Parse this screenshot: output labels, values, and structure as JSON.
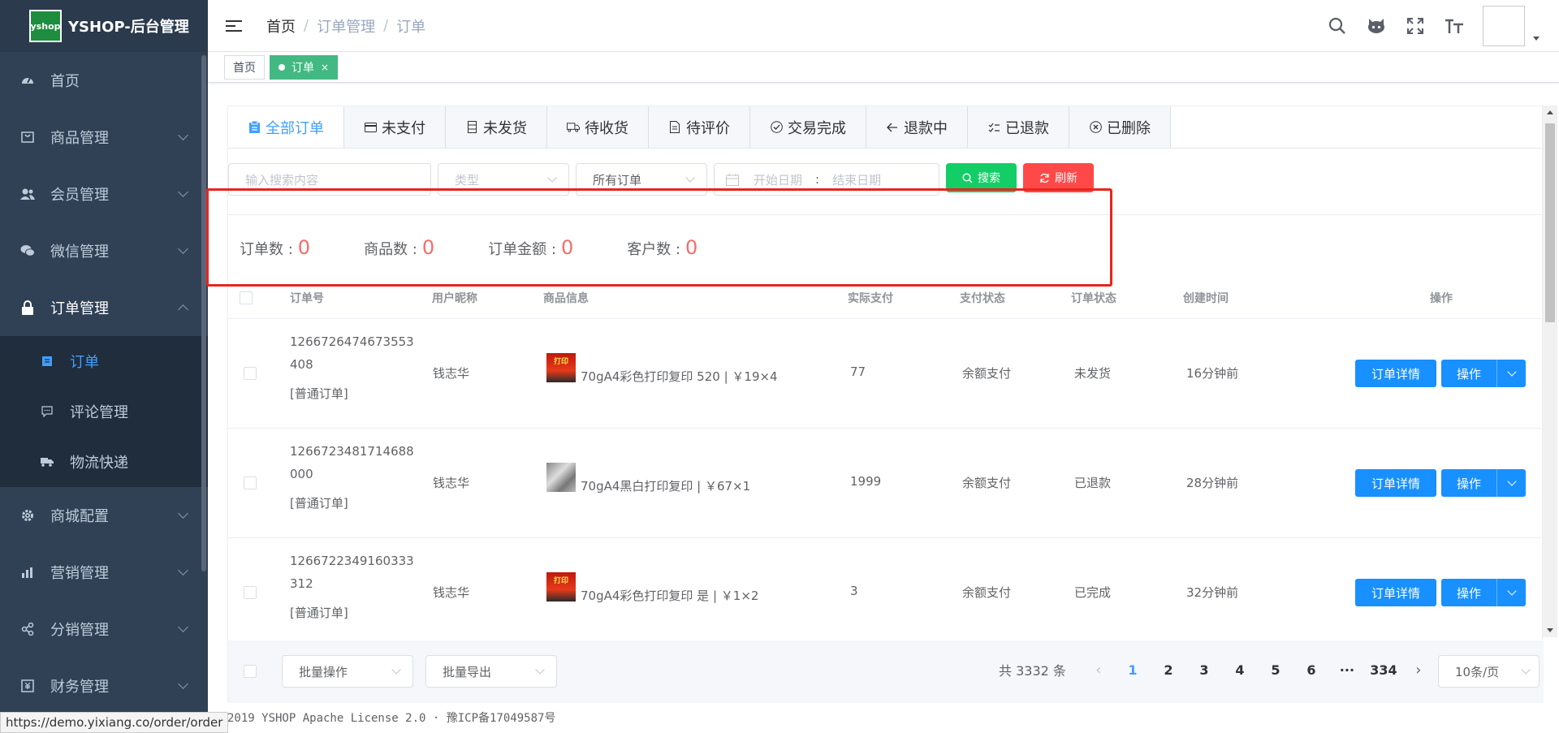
{
  "sidebar": {
    "logo_mark": "yshop",
    "logo_title": "YSHOP-后台管理",
    "items": [
      {
        "label": "首页",
        "icon": "dashboard-icon"
      },
      {
        "label": "商品管理",
        "icon": "goods-icon"
      },
      {
        "label": "会员管理",
        "icon": "users-icon"
      },
      {
        "label": "微信管理",
        "icon": "wechat-icon"
      },
      {
        "label": "订单管理",
        "icon": "lock-icon"
      },
      {
        "label": "商城配置",
        "icon": "gear-icon"
      },
      {
        "label": "营销管理",
        "icon": "chart-icon"
      },
      {
        "label": "分销管理",
        "icon": "share-icon"
      },
      {
        "label": "财务管理",
        "icon": "finance-icon"
      }
    ],
    "submenu": [
      {
        "label": "订单",
        "icon": "document-icon"
      },
      {
        "label": "评论管理",
        "icon": "comment-icon"
      },
      {
        "label": "物流快递",
        "icon": "truck-icon"
      }
    ]
  },
  "header": {
    "breadcrumb": [
      "首页",
      "订单管理",
      "订单"
    ]
  },
  "tagsview": {
    "home": "首页",
    "current": "订单",
    "close": "×"
  },
  "tabs": [
    "全部订单",
    "未支付",
    "未发货",
    "待收货",
    "待评价",
    "交易完成",
    "退款中",
    "已退款",
    "已删除"
  ],
  "filter": {
    "search_placeholder": "输入搜索内容",
    "type_placeholder": "类型",
    "order_select": "所有订单",
    "start_date": "开始日期",
    "date_sep": ":",
    "end_date": "结束日期",
    "search_btn": "搜索",
    "refresh_btn": "刷新"
  },
  "stats": [
    {
      "label": "订单数 :",
      "value": "0"
    },
    {
      "label": "商品数 :",
      "value": "0"
    },
    {
      "label": "订单金额 :",
      "value": "0"
    },
    {
      "label": "客户数 :",
      "value": "0"
    }
  ],
  "table": {
    "headers": [
      "订单号",
      "用户昵称",
      "商品信息",
      "实际支付",
      "支付状态",
      "订单状态",
      "创建时间",
      "操作"
    ],
    "rows": [
      {
        "order_no": "1266726474673553408",
        "order_type": "[普通订单]",
        "nickname": "钱志华",
        "product": "70gA4彩色打印复印 520 | ￥19×4",
        "paid": "77",
        "pay_status": "余额支付",
        "order_status": "未发货",
        "created": "16分钟前",
        "img": "red"
      },
      {
        "order_no": "1266723481714688000",
        "order_type": "[普通订单]",
        "nickname": "钱志华",
        "product": "70gA4黑白打印复印 | ￥67×1",
        "paid": "1999",
        "pay_status": "余额支付",
        "order_status": "已退款",
        "created": "28分钟前",
        "img": "gray"
      },
      {
        "order_no": "1266722349160333312",
        "order_type": "[普通订单]",
        "nickname": "钱志华",
        "product": "70gA4彩色打印复印 是 | ￥1×2",
        "paid": "3",
        "pay_status": "余额支付",
        "order_status": "已完成",
        "created": "32分钟前",
        "img": "red"
      }
    ],
    "detail_btn": "订单详情",
    "action_btn": "操作",
    "thumb_text": "打印"
  },
  "bottom": {
    "batch_ops": "批量操作",
    "batch_export": "批量导出",
    "total": "共 3332 条",
    "pages": [
      "1",
      "2",
      "3",
      "4",
      "5",
      "6",
      "···",
      "334"
    ],
    "page_size": "10条/页"
  },
  "footer": "2019 YSHOP Apache License 2.0 · 豫ICP备17049587号",
  "status_url": "https://demo.yixiang.co/order/order"
}
